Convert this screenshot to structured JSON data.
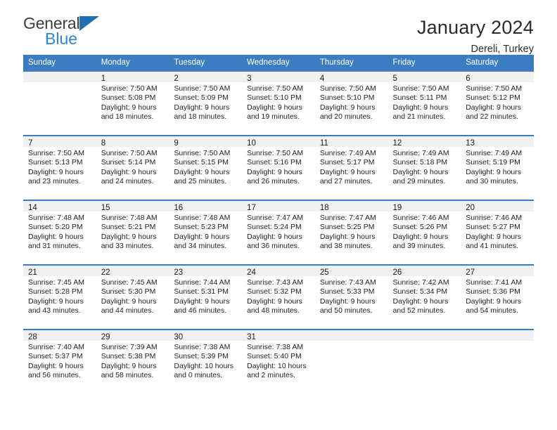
{
  "brand": {
    "line1": "General",
    "line2": "Blue",
    "triangle_color": "#1f6fb5",
    "line2_color": "#2e86d4"
  },
  "header": {
    "title": "January 2024",
    "subtitle": "Dereli, Turkey"
  },
  "theme": {
    "header_bg": "#3b7dc0",
    "daynum_bg": "#f1f1f1",
    "text": "#1f1f1f"
  },
  "weekdays": [
    "Sunday",
    "Monday",
    "Tuesday",
    "Wednesday",
    "Thursday",
    "Friday",
    "Saturday"
  ],
  "weeks": [
    [
      {
        "day": "",
        "lines": []
      },
      {
        "day": "1",
        "lines": [
          "Sunrise: 7:50 AM",
          "Sunset: 5:08 PM",
          "Daylight: 9 hours",
          "and 18 minutes."
        ]
      },
      {
        "day": "2",
        "lines": [
          "Sunrise: 7:50 AM",
          "Sunset: 5:09 PM",
          "Daylight: 9 hours",
          "and 18 minutes."
        ]
      },
      {
        "day": "3",
        "lines": [
          "Sunrise: 7:50 AM",
          "Sunset: 5:10 PM",
          "Daylight: 9 hours",
          "and 19 minutes."
        ]
      },
      {
        "day": "4",
        "lines": [
          "Sunrise: 7:50 AM",
          "Sunset: 5:10 PM",
          "Daylight: 9 hours",
          "and 20 minutes."
        ]
      },
      {
        "day": "5",
        "lines": [
          "Sunrise: 7:50 AM",
          "Sunset: 5:11 PM",
          "Daylight: 9 hours",
          "and 21 minutes."
        ]
      },
      {
        "day": "6",
        "lines": [
          "Sunrise: 7:50 AM",
          "Sunset: 5:12 PM",
          "Daylight: 9 hours",
          "and 22 minutes."
        ]
      }
    ],
    [
      {
        "day": "7",
        "lines": [
          "Sunrise: 7:50 AM",
          "Sunset: 5:13 PM",
          "Daylight: 9 hours",
          "and 23 minutes."
        ]
      },
      {
        "day": "8",
        "lines": [
          "Sunrise: 7:50 AM",
          "Sunset: 5:14 PM",
          "Daylight: 9 hours",
          "and 24 minutes."
        ]
      },
      {
        "day": "9",
        "lines": [
          "Sunrise: 7:50 AM",
          "Sunset: 5:15 PM",
          "Daylight: 9 hours",
          "and 25 minutes."
        ]
      },
      {
        "day": "10",
        "lines": [
          "Sunrise: 7:50 AM",
          "Sunset: 5:16 PM",
          "Daylight: 9 hours",
          "and 26 minutes."
        ]
      },
      {
        "day": "11",
        "lines": [
          "Sunrise: 7:49 AM",
          "Sunset: 5:17 PM",
          "Daylight: 9 hours",
          "and 27 minutes."
        ]
      },
      {
        "day": "12",
        "lines": [
          "Sunrise: 7:49 AM",
          "Sunset: 5:18 PM",
          "Daylight: 9 hours",
          "and 29 minutes."
        ]
      },
      {
        "day": "13",
        "lines": [
          "Sunrise: 7:49 AM",
          "Sunset: 5:19 PM",
          "Daylight: 9 hours",
          "and 30 minutes."
        ]
      }
    ],
    [
      {
        "day": "14",
        "lines": [
          "Sunrise: 7:48 AM",
          "Sunset: 5:20 PM",
          "Daylight: 9 hours",
          "and 31 minutes."
        ]
      },
      {
        "day": "15",
        "lines": [
          "Sunrise: 7:48 AM",
          "Sunset: 5:21 PM",
          "Daylight: 9 hours",
          "and 33 minutes."
        ]
      },
      {
        "day": "16",
        "lines": [
          "Sunrise: 7:48 AM",
          "Sunset: 5:23 PM",
          "Daylight: 9 hours",
          "and 34 minutes."
        ]
      },
      {
        "day": "17",
        "lines": [
          "Sunrise: 7:47 AM",
          "Sunset: 5:24 PM",
          "Daylight: 9 hours",
          "and 36 minutes."
        ]
      },
      {
        "day": "18",
        "lines": [
          "Sunrise: 7:47 AM",
          "Sunset: 5:25 PM",
          "Daylight: 9 hours",
          "and 38 minutes."
        ]
      },
      {
        "day": "19",
        "lines": [
          "Sunrise: 7:46 AM",
          "Sunset: 5:26 PM",
          "Daylight: 9 hours",
          "and 39 minutes."
        ]
      },
      {
        "day": "20",
        "lines": [
          "Sunrise: 7:46 AM",
          "Sunset: 5:27 PM",
          "Daylight: 9 hours",
          "and 41 minutes."
        ]
      }
    ],
    [
      {
        "day": "21",
        "lines": [
          "Sunrise: 7:45 AM",
          "Sunset: 5:28 PM",
          "Daylight: 9 hours",
          "and 43 minutes."
        ]
      },
      {
        "day": "22",
        "lines": [
          "Sunrise: 7:45 AM",
          "Sunset: 5:30 PM",
          "Daylight: 9 hours",
          "and 44 minutes."
        ]
      },
      {
        "day": "23",
        "lines": [
          "Sunrise: 7:44 AM",
          "Sunset: 5:31 PM",
          "Daylight: 9 hours",
          "and 46 minutes."
        ]
      },
      {
        "day": "24",
        "lines": [
          "Sunrise: 7:43 AM",
          "Sunset: 5:32 PM",
          "Daylight: 9 hours",
          "and 48 minutes."
        ]
      },
      {
        "day": "25",
        "lines": [
          "Sunrise: 7:43 AM",
          "Sunset: 5:33 PM",
          "Daylight: 9 hours",
          "and 50 minutes."
        ]
      },
      {
        "day": "26",
        "lines": [
          "Sunrise: 7:42 AM",
          "Sunset: 5:34 PM",
          "Daylight: 9 hours",
          "and 52 minutes."
        ]
      },
      {
        "day": "27",
        "lines": [
          "Sunrise: 7:41 AM",
          "Sunset: 5:36 PM",
          "Daylight: 9 hours",
          "and 54 minutes."
        ]
      }
    ],
    [
      {
        "day": "28",
        "lines": [
          "Sunrise: 7:40 AM",
          "Sunset: 5:37 PM",
          "Daylight: 9 hours",
          "and 56 minutes."
        ]
      },
      {
        "day": "29",
        "lines": [
          "Sunrise: 7:39 AM",
          "Sunset: 5:38 PM",
          "Daylight: 9 hours",
          "and 58 minutes."
        ]
      },
      {
        "day": "30",
        "lines": [
          "Sunrise: 7:38 AM",
          "Sunset: 5:39 PM",
          "Daylight: 10 hours",
          "and 0 minutes."
        ]
      },
      {
        "day": "31",
        "lines": [
          "Sunrise: 7:38 AM",
          "Sunset: 5:40 PM",
          "Daylight: 10 hours",
          "and 2 minutes."
        ]
      },
      {
        "day": "",
        "lines": []
      },
      {
        "day": "",
        "lines": []
      },
      {
        "day": "",
        "lines": []
      }
    ]
  ]
}
